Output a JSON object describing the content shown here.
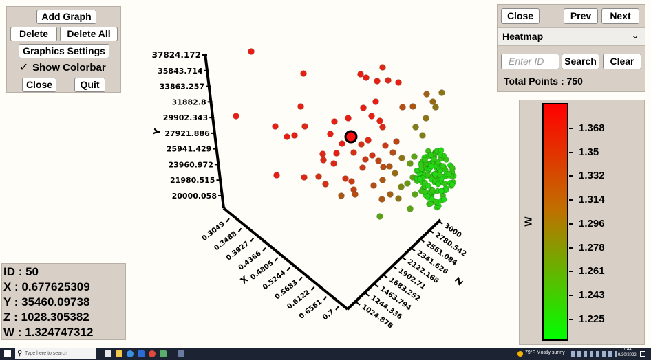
{
  "left_panel": {
    "add_graph": "Add Graph",
    "delete": "Delete",
    "delete_all": "Delete All",
    "graphics_settings": "Graphics Settings",
    "show_colorbar": "Show Colorbar",
    "show_colorbar_checked": true,
    "close": "Close",
    "quit": "Quit"
  },
  "right_panel": {
    "close": "Close",
    "prev": "Prev",
    "next": "Next",
    "colormap_selected": "Heatmap",
    "id_placeholder": "Enter ID",
    "search": "Search",
    "clear": "Clear",
    "total_points": "Total Points : 750"
  },
  "colorbar": {
    "label": "W",
    "ticks": [
      "1.368",
      "1.35",
      "1.332",
      "1.314",
      "1.296",
      "1.278",
      "1.261",
      "1.243",
      "1.225"
    ],
    "color_high": "#ff0000",
    "color_low": "#00ff00"
  },
  "info": {
    "id": "ID : 50",
    "x": "X : 0.677625309",
    "y": "Y : 35460.09738",
    "z": "Z : 1028.305382",
    "w": "W : 1.324747312"
  },
  "axes": {
    "y_label": "Y",
    "x_label": "X",
    "z_label": "Z",
    "y_ticks": [
      "37824.172",
      "35843.714",
      "33863.257",
      "31882.8",
      "29902.343",
      "27921.886",
      "25941.429",
      "23960.972",
      "21980.515",
      "20000.058"
    ],
    "x_ticks": [
      "0.3049",
      "0.3488",
      "0.3927",
      "0.4366",
      "0.4805",
      "0.5244",
      "0.5683",
      "0.6122",
      "0.6561",
      "0.7"
    ],
    "z_ticks": [
      "3000",
      "2780.542",
      "2561.084",
      "2341.626",
      "2122.168",
      "1902.71",
      "1683.252",
      "1463.794",
      "1244.336",
      "1024.878"
    ]
  },
  "taskbar": {
    "search_placeholder": "Type here to search",
    "weather": "79°F Mostly sunny",
    "time": "1:44",
    "date": "9/30/2022"
  }
}
